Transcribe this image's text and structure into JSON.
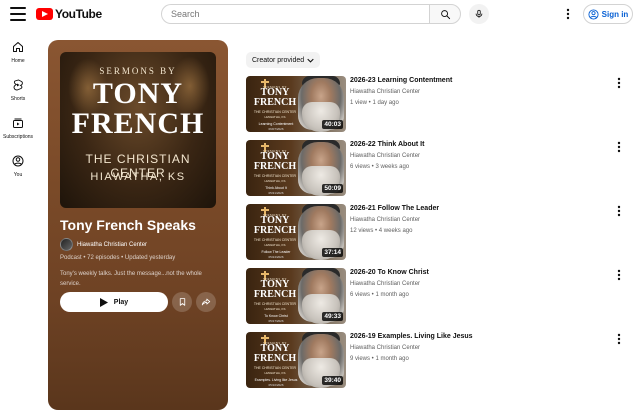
{
  "header": {
    "logo_text": "YouTube",
    "search_placeholder": "Search",
    "signin_label": "Sign in"
  },
  "nav": {
    "items": [
      {
        "label": "Home",
        "icon": "home-icon"
      },
      {
        "label": "Shorts",
        "icon": "shorts-icon"
      },
      {
        "label": "Subscriptions",
        "icon": "subscriptions-icon"
      },
      {
        "label": "You",
        "icon": "you-icon"
      }
    ]
  },
  "playlist": {
    "cover": {
      "line1": "SERMONS BY",
      "line2": "TONY",
      "line3": "FRENCH",
      "line4": "THE CHRISTIAN CENTER",
      "line5": "HIAWATHA, KS"
    },
    "title": "Tony French Speaks",
    "owner": "Hiawatha Christian Center",
    "meta": "Podcast • 72 episodes • Updated yesterday",
    "description": "Tony's weekly talks. Just the message...not the whole service.",
    "play_label": "Play"
  },
  "filter": {
    "chip_label": "Creator provided"
  },
  "thumb_text": {
    "small": "SERMONS BY",
    "big1": "TONY",
    "big2": "FRENCH",
    "c1": "THE CHRISTIAN CENTER",
    "c2": "HIAWATHA, KS"
  },
  "videos": [
    {
      "title": "2026-23 Learning Contentment",
      "channel": "Hiawatha Christian Center",
      "meta": "1 view • 1 day ago",
      "duration": "40:03",
      "thumb_ep": "Learning Contentment",
      "thumb_date": "06/07/2026"
    },
    {
      "title": "2026-22 Think About It",
      "channel": "Hiawatha Christian Center",
      "meta": "6 views • 3 weeks ago",
      "duration": "50:09",
      "thumb_ep": "Think About It",
      "thumb_date": "05/31/2026"
    },
    {
      "title": "2026-21 Follow The Leader",
      "channel": "Hiawatha Christian Center",
      "meta": "12 views • 4 weeks ago",
      "duration": "37:14",
      "thumb_ep": "Follow The Leader",
      "thumb_date": "05/24/2026"
    },
    {
      "title": "2026-20 To Know Christ",
      "channel": "Hiawatha Christian Center",
      "meta": "6 views • 1 month ago",
      "duration": "49:33",
      "thumb_ep": "To Know Christ",
      "thumb_date": "05/17/2026"
    },
    {
      "title": "2026-19 Examples. Living Like Jesus",
      "channel": "Hiawatha Christian Center",
      "meta": "9 views • 1 month ago",
      "duration": "39:40",
      "thumb_ep": "Examples. Living like Jesus",
      "thumb_date": "05/10/2026"
    }
  ]
}
